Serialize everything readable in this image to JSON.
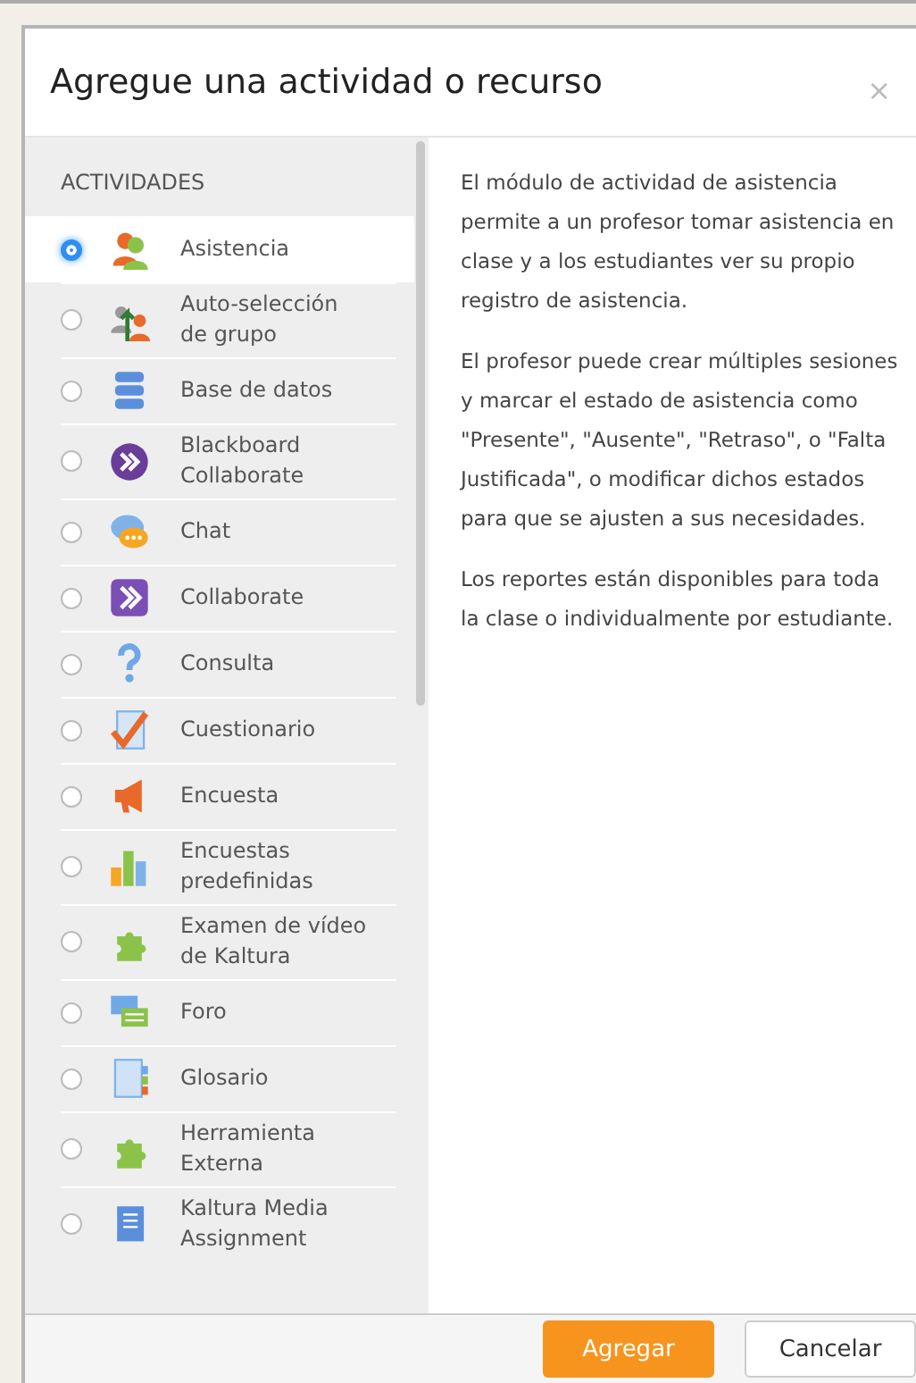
{
  "dialog": {
    "title": "Agregue una actividad o recurso",
    "close": "×"
  },
  "section_heading": "ACTIVIDADES",
  "items": [
    {
      "label": "Asistencia",
      "selected": true
    },
    {
      "label": "Auto-selección de grupo",
      "selected": false
    },
    {
      "label": "Base de datos",
      "selected": false
    },
    {
      "label": "Blackboard Collaborate",
      "selected": false
    },
    {
      "label": "Chat",
      "selected": false
    },
    {
      "label": "Collaborate",
      "selected": false
    },
    {
      "label": "Consulta",
      "selected": false
    },
    {
      "label": "Cuestionario",
      "selected": false
    },
    {
      "label": "Encuesta",
      "selected": false
    },
    {
      "label": "Encuestas predefinidas",
      "selected": false
    },
    {
      "label": "Examen de vídeo de Kaltura",
      "selected": false
    },
    {
      "label": "Foro",
      "selected": false
    },
    {
      "label": "Glosario",
      "selected": false
    },
    {
      "label": "Herramienta Externa",
      "selected": false
    },
    {
      "label": "Kaltura Media Assignment",
      "selected": false
    }
  ],
  "description": [
    "El módulo de actividad de asistencia permite a un profesor tomar asistencia en clase y a los estudiantes ver su propio registro de asistencia.",
    "El profesor puede crear múltiples sesiones y marcar el estado de asistencia como \"Presente\", \"Ausente\", \"Retraso\", o \"Falta Justificada\", o modificar dichos estados para que se ajusten a sus necesidades.",
    "Los reportes están disponibles para toda la clase o individualmente por estudiante."
  ],
  "buttons": {
    "primary": "Agregar",
    "secondary": "Cancelar"
  }
}
